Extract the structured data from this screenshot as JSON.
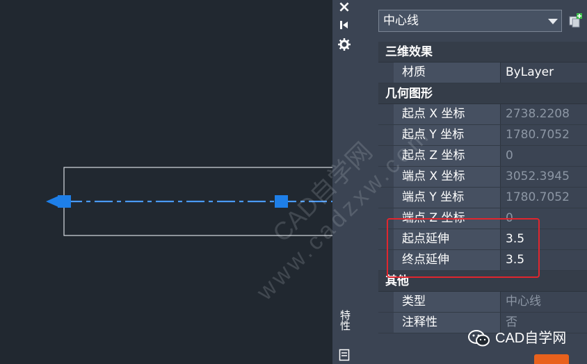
{
  "toolbar": {
    "close_icon": "×",
    "pin_icon": "auto-hide-icon",
    "settings_icon": "gear-icon",
    "vertical_label": "特性"
  },
  "panel": {
    "selector_value": "中心线",
    "sections": {
      "effects": {
        "title": "三维效果",
        "material": {
          "key": "材质",
          "value": "ByLayer"
        }
      },
      "geometry": {
        "title": "几何图形",
        "start_x": {
          "key": "起点 X 坐标",
          "value": "2738.2208"
        },
        "start_y": {
          "key": "起点 Y 坐标",
          "value": "1780.7052"
        },
        "start_z": {
          "key": "起点 Z 坐标",
          "value": "0"
        },
        "end_x": {
          "key": "端点 X 坐标",
          "value": "3052.3945"
        },
        "end_y": {
          "key": "端点 Y 坐标",
          "value": "1780.7052"
        },
        "end_z": {
          "key": "端点 Z 坐标",
          "value": "0"
        },
        "start_ext": {
          "key": "起点延伸",
          "value": "3.5"
        },
        "end_ext": {
          "key": "终点延伸",
          "value": "3.5"
        }
      },
      "other": {
        "title": "其他",
        "type": {
          "key": "类型",
          "value": "中心线"
        },
        "annotative": {
          "key": "注释性",
          "value": "否"
        }
      }
    }
  },
  "watermark": {
    "line1": "CAD自学网",
    "line2": "www.cadzxw.com"
  },
  "badge": {
    "text": "CAD自学网"
  },
  "colors": {
    "canvas": "#212830",
    "panel": "#3b4453",
    "grip": "#1e7fe8",
    "centerline": "#2f8bf0",
    "highlight": "#e1262e"
  }
}
